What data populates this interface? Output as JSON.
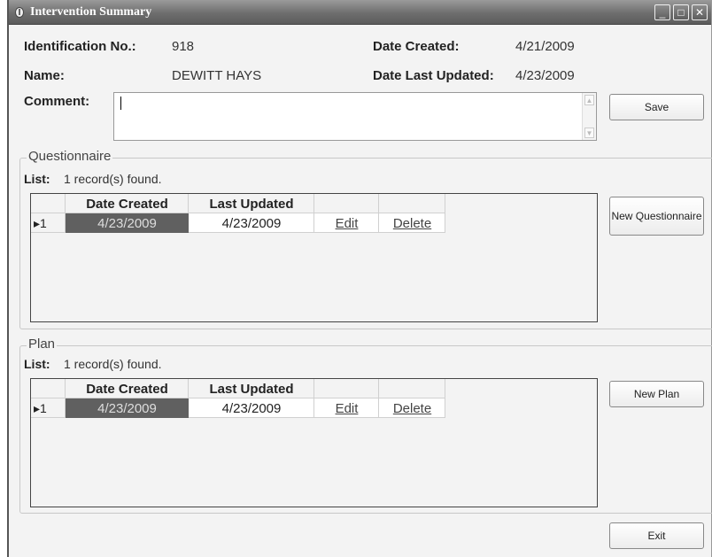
{
  "window": {
    "title": "Intervention Summary",
    "controls": {
      "minimize": "_",
      "maximize": "□",
      "close": "✕"
    }
  },
  "fields": {
    "id_label": "Identification No.:",
    "id_value": "918",
    "name_label": "Name:",
    "name_value": "DEWITT HAYS",
    "date_created_label": "Date Created:",
    "date_created_value": "4/21/2009",
    "date_updated_label": "Date Last Updated:",
    "date_updated_value": "4/23/2009",
    "comment_label": "Comment:",
    "comment_value": ""
  },
  "buttons": {
    "save": "Save",
    "new_questionnaire": "New Questionnaire",
    "new_plan": "New Plan",
    "exit": "Exit"
  },
  "questionnaire": {
    "title": "Questionnaire",
    "list_label": "List:",
    "list_count": "1 record(s) found.",
    "columns": [
      "Date Created",
      "Last Updated"
    ],
    "rows": [
      {
        "indicator": "▸1",
        "date_created": "4/23/2009",
        "last_updated": "4/23/2009",
        "edit": "Edit",
        "delete": "Delete"
      }
    ]
  },
  "plan": {
    "title": "Plan",
    "list_label": "List:",
    "list_count": "1 record(s) found.",
    "columns": [
      "Date Created",
      "Last Updated"
    ],
    "rows": [
      {
        "indicator": "▸1",
        "date_created": "4/23/2009",
        "last_updated": "4/23/2009",
        "edit": "Edit",
        "delete": "Delete"
      }
    ]
  },
  "icons": {
    "app": "app-icon",
    "scroll_up": "scroll-up-icon",
    "scroll_down": "scroll-down-icon"
  }
}
